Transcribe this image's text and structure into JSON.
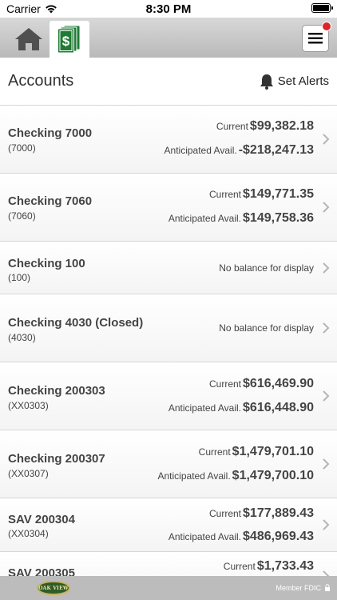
{
  "status_bar": {
    "carrier": "Carrier",
    "time": "8:30 PM",
    "battery_level": 1.0
  },
  "nav": {
    "tabs": [
      {
        "name": "home",
        "icon": "home-icon"
      },
      {
        "name": "accounts",
        "icon": "dollar-icon",
        "active": true
      }
    ],
    "menu_icon": "hamburger-menu-icon",
    "notification_dot_color": "#e0242a"
  },
  "header": {
    "title": "Accounts",
    "set_alerts_label": "Set Alerts",
    "bell_icon": "bell-icon"
  },
  "accounts": [
    {
      "name": "Checking 7000",
      "number": "(7000)",
      "current_label": "Current",
      "current": "$99,382.18",
      "anticipated_label": "Anticipated Avail.",
      "anticipated": "-$218,247.13"
    },
    {
      "name": "Checking 7060",
      "number": "(7060)",
      "current_label": "Current",
      "current": "$149,771.35",
      "anticipated_label": "Anticipated Avail.",
      "anticipated": "$149,758.36"
    },
    {
      "name": "Checking 100",
      "number": "(100)",
      "no_balance": "No balance for display"
    },
    {
      "name": "Checking 4030 (Closed)",
      "number": "(4030)",
      "no_balance": "No balance for display"
    },
    {
      "name": "Checking 200303",
      "number": "(XX0303)",
      "current_label": "Current",
      "current": "$616,469.90",
      "anticipated_label": "Anticipated Avail.",
      "anticipated": "$616,448.90"
    },
    {
      "name": "Checking 200307",
      "number": "(XX0307)",
      "current_label": "Current",
      "current": "$1,479,701.10",
      "anticipated_label": "Anticipated Avail.",
      "anticipated": "$1,479,700.10"
    },
    {
      "name": "SAV 200304",
      "number": "(XX0304)",
      "current_label": "Current",
      "current": "$177,889.43",
      "anticipated_label": "Anticipated Avail.",
      "anticipated": "$486,969.43"
    },
    {
      "name": "SAV 200305",
      "number": "",
      "current_label": "Current",
      "current": "$1,733.43"
    }
  ],
  "footer": {
    "logo_text": "OAK VIEW",
    "member_fdic": "Member FDIC",
    "lock_icon": "lock-icon"
  },
  "colors": {
    "nav_gradient_top": "#d8d8d8",
    "nav_gradient_bottom": "#b9b9b9",
    "dollar_green": "#1f7a34",
    "footer_bg": "#bcbcbc",
    "text_gray": "#444444"
  }
}
